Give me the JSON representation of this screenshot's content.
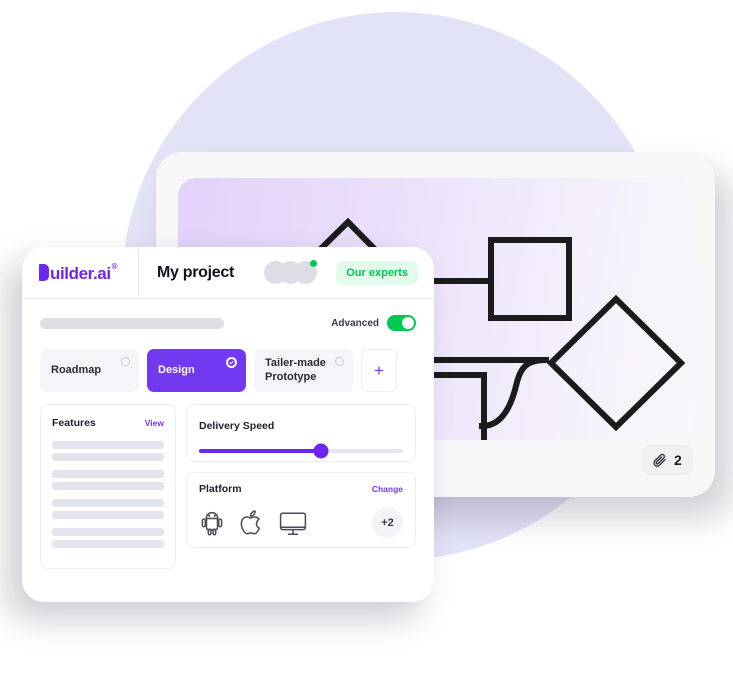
{
  "background": {
    "circle_color": "#E3E3F7"
  },
  "back_card": {
    "name": "diagram-window",
    "panel_gradient_from": "#E3D2FA",
    "panel_gradient_to": "#F8F7FB",
    "diagram": {
      "type": "flowchart",
      "shapes": [
        "chevron",
        "square",
        "square",
        "diamond"
      ],
      "connectors": [
        "line",
        "line",
        "line",
        "curve"
      ]
    },
    "attachments": {
      "icon": "paperclip-icon",
      "count": "2"
    }
  },
  "front_card": {
    "header": {
      "logo": {
        "mark": "b-block-icon",
        "word": "uilder.ai",
        "registered": "®"
      },
      "project_title": "My project",
      "avatars": [
        {
          "name": "avatar-1"
        },
        {
          "name": "avatar-2"
        },
        {
          "name": "avatar-3"
        }
      ],
      "status_dot_color": "#00C853",
      "experts_pill": "Our experts"
    },
    "toolbar": {
      "search_placeholder": "",
      "advanced_label": "Advanced",
      "advanced_on": true,
      "toggle_color": "#00C853"
    },
    "chips": [
      {
        "label": "Roadmap",
        "selected": false
      },
      {
        "label": "Design",
        "selected": true
      },
      {
        "label": "Tailer-made Prototype",
        "selected": false
      }
    ],
    "add_chip_label": "+",
    "features": {
      "title": "Features",
      "link": "View",
      "skeleton_groups": 4,
      "rows_per_group": 2
    },
    "delivery_speed": {
      "title": "Delivery Speed",
      "value_percent": 60,
      "accent": "#6D28F0"
    },
    "platform": {
      "title": "Platform",
      "link": "Change",
      "icons": [
        "android-icon",
        "apple-icon",
        "desktop-icon"
      ],
      "more_label": "+2"
    }
  }
}
